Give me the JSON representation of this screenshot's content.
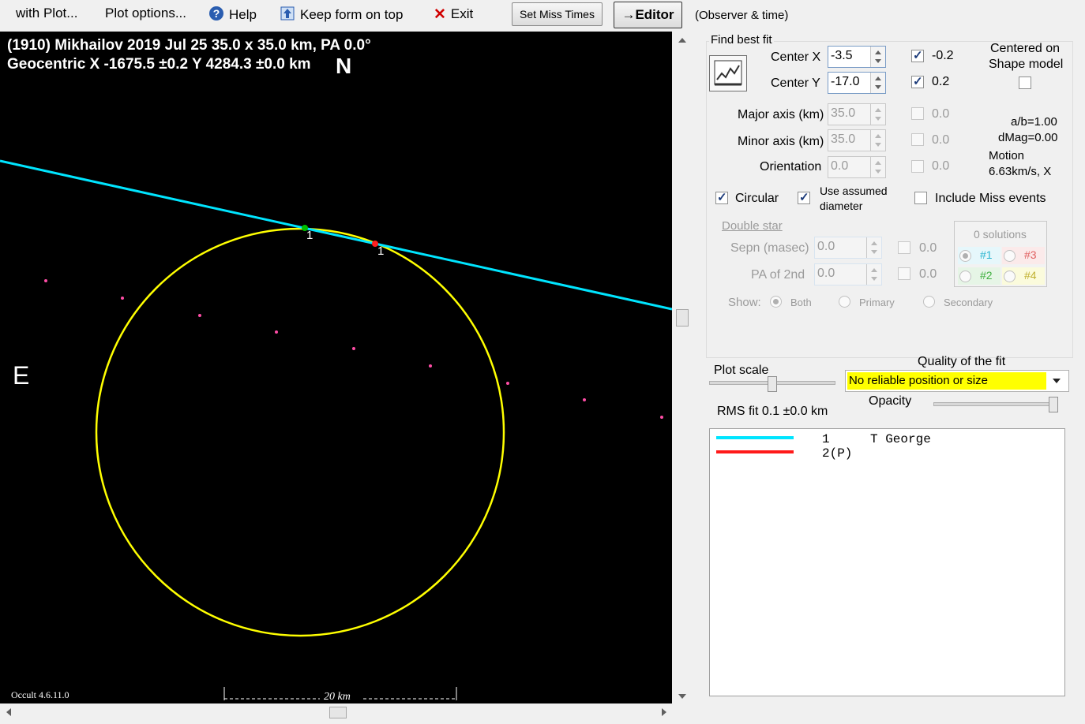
{
  "menu": {
    "with_plot": "with Plot...",
    "plot_options": "Plot options...",
    "help": "Help",
    "keep_on_top": "Keep form on top",
    "exit": "Exit",
    "set_miss_times": "Set Miss Times",
    "editor": "→Editor",
    "observer_time": "(Observer & time)"
  },
  "plot": {
    "title_line1": "(1910) Mikhailov  2019 Jul 25   35.0 x 35.0 km, PA 0.0°",
    "title_line2": "Geocentric  X  -1675.5 ±0.2   Y 4284.3 ±0.0 km",
    "north": "N",
    "east": "E",
    "version": "Occult 4.6.11.0",
    "scale_label": "20 km",
    "chord_label_1": "1",
    "chord_label_2": "1"
  },
  "fit": {
    "find_best_fit": "Find best fit",
    "center_x_label": "Center X",
    "center_x_value": "-3.5",
    "center_x_unc": "-0.2",
    "center_y_label": "Center Y",
    "center_y_value": "-17.0",
    "center_y_unc": "0.2",
    "centered_on_shape_line1": "Centered on",
    "centered_on_shape_line2": "Shape model",
    "major_label": "Major axis (km)",
    "major_value": "35.0",
    "major_unc": "0.0",
    "minor_label": "Minor axis (km)",
    "minor_value": "35.0",
    "minor_unc": "0.0",
    "orient_label": "Orientation",
    "orient_value": "0.0",
    "orient_unc": "0.0",
    "ab": "a/b=1.00",
    "dmag": "dMag=0.00",
    "motion_label": "Motion",
    "motion_value": "6.63km/s, X",
    "circular": "Circular",
    "use_assumed_line1": "Use assumed",
    "use_assumed_line2": "diameter",
    "include_miss": "Include Miss events"
  },
  "double_star": {
    "title": "Double star",
    "sepn_label": "Sepn (masec)",
    "sepn_value": "0.0",
    "sepn_unc": "0.0",
    "pa_label": "PA of 2nd",
    "pa_value": "0.0",
    "pa_unc": "0.0",
    "solutions": "0 solutions",
    "sol1": "#1",
    "sol2": "#2",
    "sol3": "#3",
    "sol4": "#4",
    "show_label": "Show:",
    "show_both": "Both",
    "show_primary": "Primary",
    "show_secondary": "Secondary"
  },
  "bottom": {
    "plot_scale": "Plot scale",
    "quality_label": "Quality of the fit",
    "quality_value": "No reliable position or size",
    "opacity": "Opacity",
    "rms": "RMS fit 0.1 ±0.0 km"
  },
  "legend": [
    {
      "num": "1",
      "name": "T George",
      "color": "#00e5ff"
    },
    {
      "num": "2(P)",
      "name": "",
      "color": "#ff1a1a"
    }
  ],
  "colors": {
    "chord": "#00e5ff",
    "limb": "#ffff00",
    "miss_dots": "#ff4da6",
    "quality_bg": "#ffff00"
  }
}
